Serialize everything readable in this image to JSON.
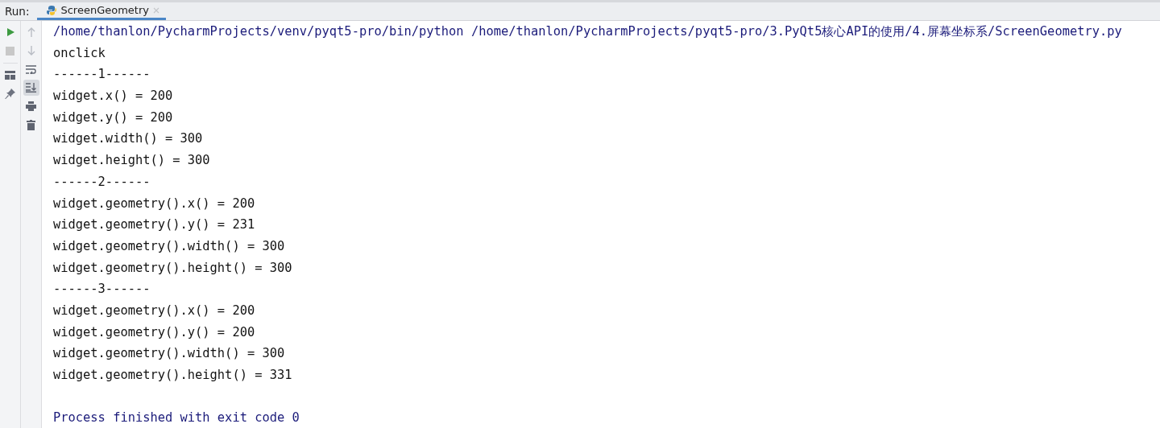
{
  "run_panel": {
    "label": "Run:",
    "tabs": [
      {
        "label": "ScreenGeometry",
        "selected": true
      }
    ]
  },
  "toolbar_left": [
    {
      "kind": "run",
      "disabled": false
    },
    {
      "kind": "stop",
      "disabled": true
    },
    {
      "kind": "layout",
      "disabled": false
    },
    {
      "kind": "pin",
      "disabled": false
    }
  ],
  "toolbar_right": [
    {
      "kind": "up",
      "on": false
    },
    {
      "kind": "down",
      "on": false
    },
    {
      "kind": "wrap",
      "on": false
    },
    {
      "kind": "scroll-end",
      "on": true
    },
    {
      "kind": "print",
      "on": false
    },
    {
      "kind": "trash",
      "on": false
    }
  ],
  "console": {
    "lines": [
      {
        "kind": "command",
        "text": "/home/thanlon/PycharmProjects/venv/pyqt5-pro/bin/python /home/thanlon/PycharmProjects/pyqt5-pro/3.PyQt5核心API的使用/4.屏幕坐标系/ScreenGeometry.py"
      },
      {
        "kind": "output",
        "text": "onclick"
      },
      {
        "kind": "output",
        "text": "------1------"
      },
      {
        "kind": "output",
        "text": "widget.x() = 200"
      },
      {
        "kind": "output",
        "text": "widget.y() = 200"
      },
      {
        "kind": "output",
        "text": "widget.width() = 300"
      },
      {
        "kind": "output",
        "text": "widget.height() = 300"
      },
      {
        "kind": "output",
        "text": "------2------"
      },
      {
        "kind": "output",
        "text": "widget.geometry().x() = 200"
      },
      {
        "kind": "output",
        "text": "widget.geometry().y() = 231"
      },
      {
        "kind": "output",
        "text": "widget.geometry().width() = 300"
      },
      {
        "kind": "output",
        "text": "widget.geometry().height() = 300"
      },
      {
        "kind": "output",
        "text": "------3------"
      },
      {
        "kind": "output",
        "text": "widget.geometry().x() = 200"
      },
      {
        "kind": "output",
        "text": "widget.geometry().y() = 200"
      },
      {
        "kind": "output",
        "text": "widget.geometry().width() = 300"
      },
      {
        "kind": "output",
        "text": "widget.geometry().height() = 331"
      },
      {
        "kind": "blank"
      },
      {
        "kind": "system",
        "text": "Process finished with exit code 0"
      }
    ]
  }
}
